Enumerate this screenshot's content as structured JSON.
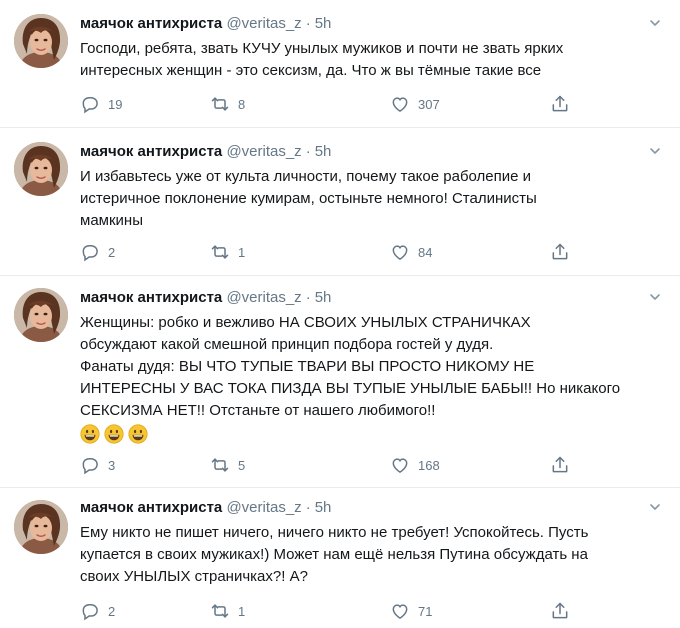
{
  "tweets": [
    {
      "name": "маячок антихриста",
      "handle": "@veritas_z",
      "time": "5h",
      "lines": [
        "Господи, ребята, звать КУЧУ унылых мужиков и почти не звать ярких",
        "интересных женщин - это сексизм, да. Что ж вы тёмные такие все"
      ],
      "replies": "19",
      "retweets": "8",
      "likes": "307"
    },
    {
      "name": "маячок антихриста",
      "handle": "@veritas_z",
      "time": "5h",
      "lines": [
        "И избавьтесь уже от культа личности, почему такое раболепие и",
        "истеричное поклонение кумирам, остыньте немного! Сталинисты",
        "мамкины"
      ],
      "replies": "2",
      "retweets": "1",
      "likes": "84"
    },
    {
      "name": "маячок антихриста",
      "handle": "@veritas_z",
      "time": "5h",
      "lines": [
        "Женщины: робко и вежливо НА СВОИХ УНЫЛЫХ СТРАНИЧКАХ",
        "обсуждают какой смешной принцип подбора гостей у дудя.",
        "Фанаты дудя: ВЫ ЧТО ТУПЫЕ ТВАРИ ВЫ ПРОСТО НИКОМУ НЕ",
        "ИНТЕРЕСНЫ У ВАС ТОКА ПИЗДА ВЫ ТУПЫЕ УНЫЛЫЕ БАБЫ!! Но никакого",
        "СЕКСИЗМА НЕТ!! Отстаньте от нашего любимого!!"
      ],
      "emojis": [
        "grinning-emoji",
        "grinning-emoji",
        "grinning-emoji"
      ],
      "replies": "3",
      "retweets": "5",
      "likes": "168"
    },
    {
      "name": "маячок антихриста",
      "handle": "@veritas_z",
      "time": "5h",
      "lines": [
        "Ему никто не пишет ничего, ничего никто не требует! Успокойтесь. Пусть",
        "купается в своих мужиках!) Может нам ещё нельзя Путина обсуждать на",
        "своих УНЫЛЫХ страничках?! А?"
      ],
      "replies": "2",
      "retweets": "1",
      "likes": "71"
    }
  ],
  "colors": {
    "text": "#14171a",
    "muted": "#657786",
    "divider": "#e6ecf0"
  }
}
